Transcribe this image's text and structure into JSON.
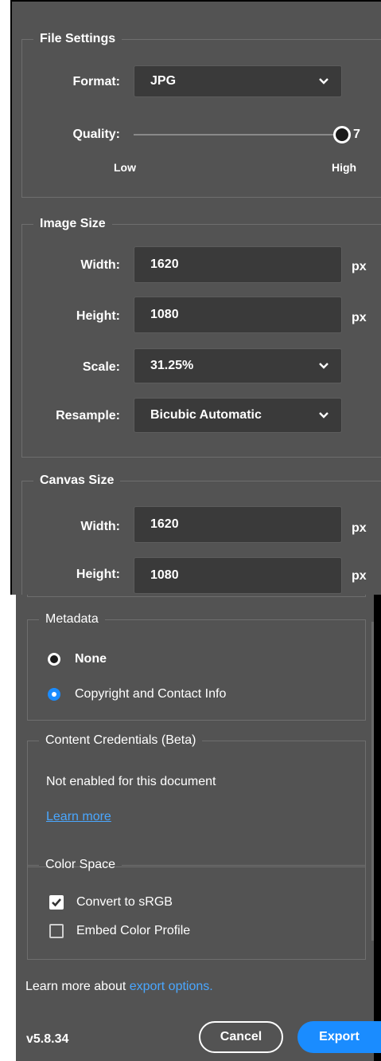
{
  "file_settings": {
    "legend": "File Settings",
    "format_label": "Format:",
    "format_value": "JPG",
    "quality_label": "Quality:",
    "quality_value": "7",
    "quality_level": 1.0,
    "low_label": "Low",
    "high_label": "High"
  },
  "image_size": {
    "legend": "Image Size",
    "width_label": "Width:",
    "width_value": "1620",
    "height_label": "Height:",
    "height_value": "1080",
    "unit": "px",
    "scale_label": "Scale:",
    "scale_value": "31.25%",
    "resample_label": "Resample:",
    "resample_value": "Bicubic Automatic"
  },
  "canvas_size": {
    "legend": "Canvas Size",
    "width_label": "Width:",
    "width_value": "1620",
    "height_label": "Height:",
    "height_value": "1080",
    "unit": "px"
  },
  "metadata": {
    "legend": "Metadata",
    "options": [
      "None",
      "Copyright and Contact Info"
    ],
    "selected": "Copyright and Contact Info"
  },
  "content_credentials": {
    "legend": "Content Credentials (Beta)",
    "status": "Not enabled for this document",
    "learn_more": "Learn more"
  },
  "color_space": {
    "legend": "Color Space",
    "convert_label": "Convert to sRGB",
    "convert_checked": true,
    "embed_label": "Embed Color Profile",
    "embed_checked": false
  },
  "footer": {
    "learn_prefix": "Learn more about ",
    "learn_link": "export options.",
    "version": "v5.8.34",
    "cancel_label": "Cancel",
    "export_label": "Export"
  },
  "colors": {
    "panel_bg": "#535353",
    "field_bg": "#3a3a3a",
    "accent": "#1a8cff",
    "link": "#4aa7ff"
  }
}
